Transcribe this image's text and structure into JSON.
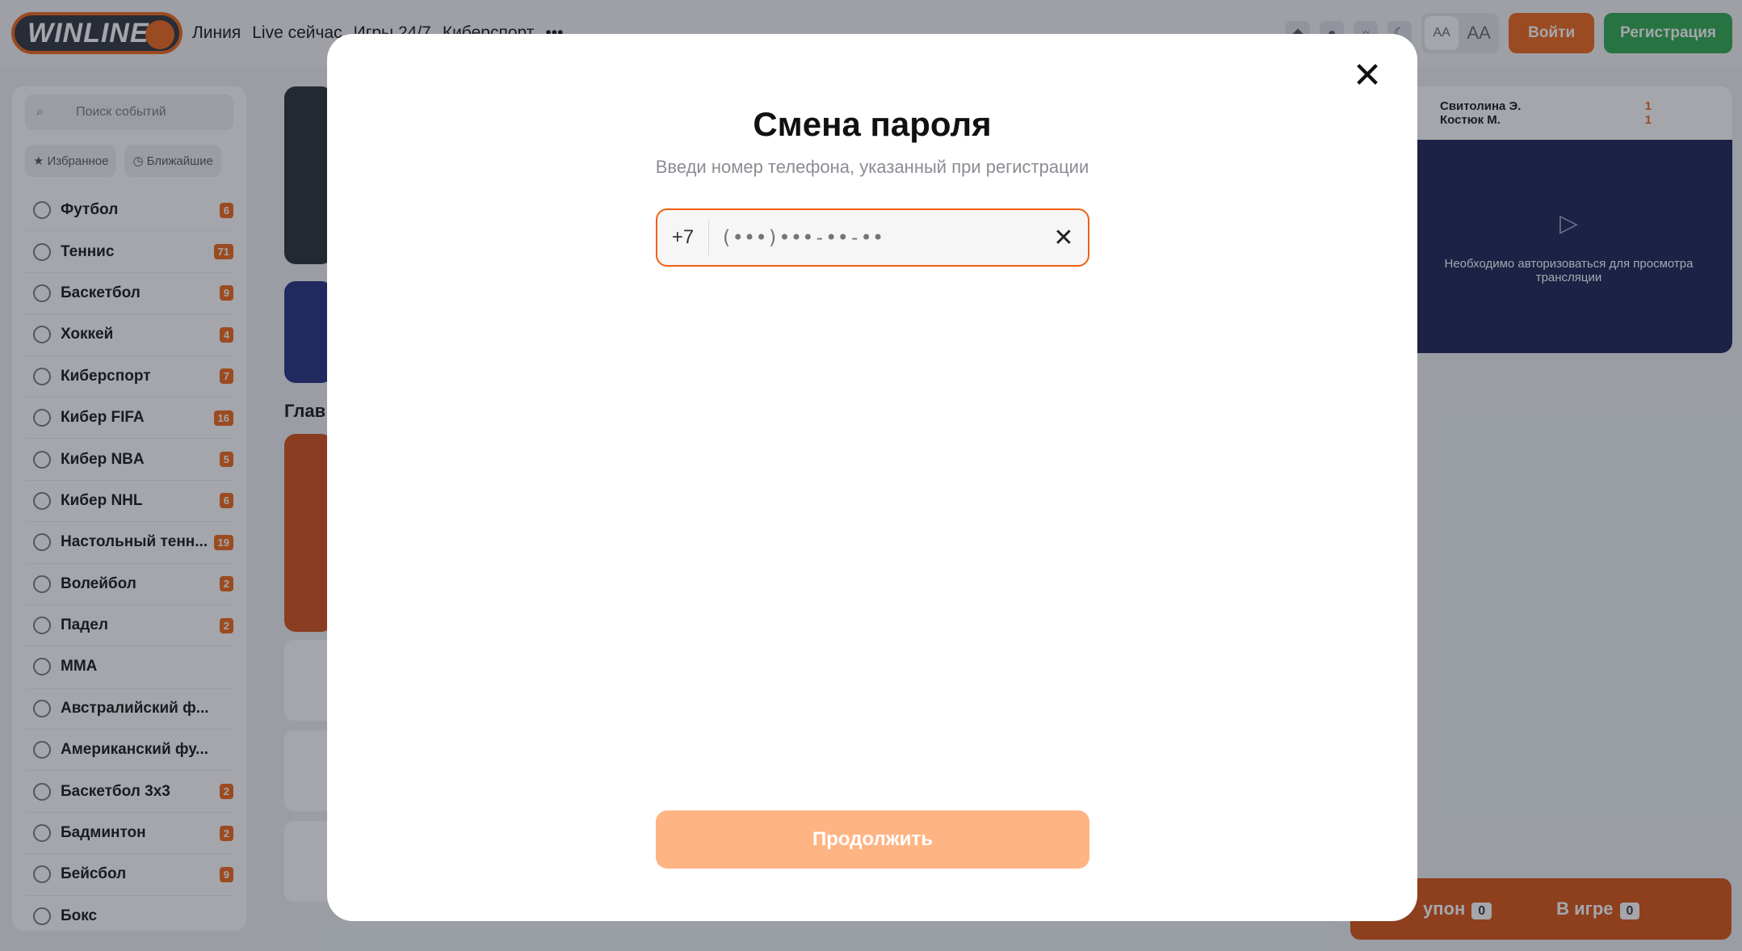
{
  "header": {
    "logo": "WINLINE",
    "nav": [
      "Линия",
      "Live сейчас",
      "Игры 24/7",
      "Киберспорт",
      "•••"
    ],
    "font_small": "AA",
    "font_large": "AA",
    "login": "Войти",
    "register": "Регистрация"
  },
  "sidebar": {
    "search_placeholder": "Поиск событий",
    "chips": [
      "Избранное",
      "Ближайшие"
    ],
    "sports": [
      {
        "name": "Футбол",
        "count": "6"
      },
      {
        "name": "Теннис",
        "count": "71"
      },
      {
        "name": "Баскетбол",
        "count": "9"
      },
      {
        "name": "Хоккей",
        "count": "4"
      },
      {
        "name": "Киберспорт",
        "count": "7"
      },
      {
        "name": "Кибер FIFA",
        "count": "16"
      },
      {
        "name": "Кибер NBA",
        "count": "5"
      },
      {
        "name": "Кибер NHL",
        "count": "6"
      },
      {
        "name": "Настольный тенн...",
        "count": "19"
      },
      {
        "name": "Волейбол",
        "count": "2"
      },
      {
        "name": "Падел",
        "count": "2"
      },
      {
        "name": "MMA",
        "count": ""
      },
      {
        "name": "Австралийский ф...",
        "count": ""
      },
      {
        "name": "Американский фу...",
        "count": ""
      },
      {
        "name": "Баскетбол 3х3",
        "count": "2"
      },
      {
        "name": "Бадминтон",
        "count": "2"
      },
      {
        "name": "Бейсбол",
        "count": "9"
      },
      {
        "name": "Бокс",
        "count": ""
      }
    ]
  },
  "center": {
    "section_title": "Глав"
  },
  "video": {
    "player1": "Свитолина Э.",
    "player2": "Костюк М.",
    "score1": "1",
    "score2": "1",
    "message": "Необходимо авторизоваться для просмотра трансляции"
  },
  "coupon": {
    "label": "упон",
    "count": "0",
    "in_game": "В игре",
    "in_game_count": "0"
  },
  "modal": {
    "title": "Смена пароля",
    "subtitle": "Введи номер телефона, указанный при регистрации",
    "prefix": "+7",
    "phone_placeholder": "(•••)•••-••-••",
    "continue": "Продолжить"
  }
}
